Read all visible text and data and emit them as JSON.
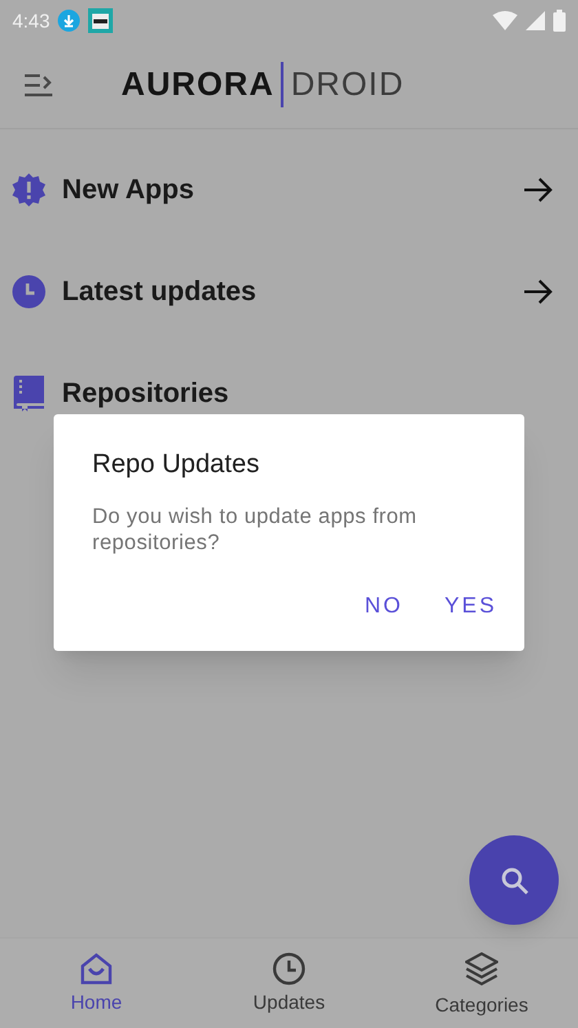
{
  "status_bar": {
    "time": "4:43"
  },
  "app_bar": {
    "logo_bold": "AURORA",
    "logo_light": "DROID"
  },
  "sections": [
    {
      "kind": "new",
      "label": "New Apps",
      "arrow": true
    },
    {
      "kind": "latest",
      "label": "Latest updates",
      "arrow": true
    },
    {
      "kind": "repos",
      "label": "Repositories",
      "arrow": false
    }
  ],
  "dialog": {
    "title": "Repo Updates",
    "message": "Do you wish to update apps from repositories?",
    "buttons": [
      "NO",
      "YES"
    ]
  },
  "bottom_nav": [
    {
      "kind": "home",
      "label": "Home",
      "selected": true
    },
    {
      "kind": "updates",
      "label": "Updates",
      "selected": false
    },
    {
      "kind": "categories",
      "label": "Categories",
      "selected": false
    }
  ]
}
